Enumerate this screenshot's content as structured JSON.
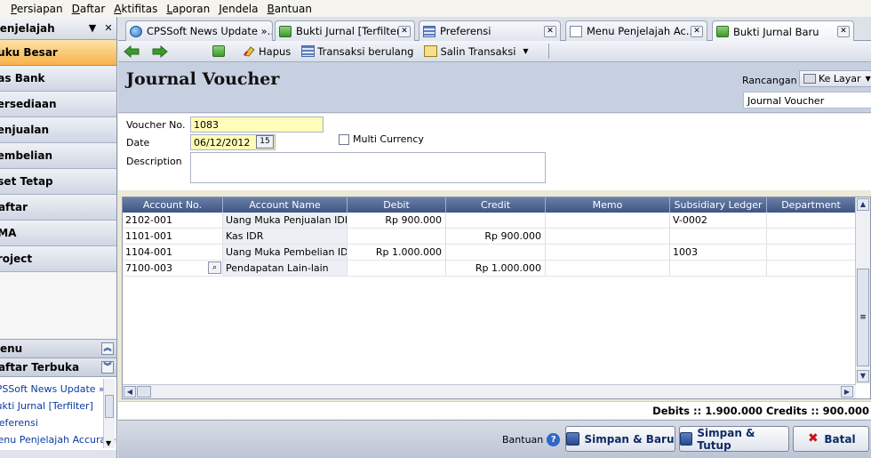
{
  "menubar": {
    "items": [
      "Persiapan",
      "Daftar",
      "Aktifitas",
      "Laporan",
      "Jendela",
      "Bantuan"
    ]
  },
  "sidebar": {
    "title": "Penjelajah",
    "items": [
      "Buku Besar",
      "Kas Bank",
      "Persediaan",
      "Penjualan",
      "Pembelian",
      "Aset Tetap",
      "Daftar",
      "RMA",
      "Project"
    ],
    "section1": "Menu",
    "section2": "Daftar Terbuka",
    "open_list": [
      "CPSSoft News Update »...",
      "Bukti Jurnal [Terfilter]",
      "Preferensi",
      "Menu Penjelajah Accurate"
    ]
  },
  "tabs": [
    {
      "label": "CPSSoft News Update »...",
      "icon": "globe-icon"
    },
    {
      "label": "Bukti Jurnal [Terfilter]",
      "icon": "journal-icon"
    },
    {
      "label": "Preferensi",
      "icon": "settings-icon"
    },
    {
      "label": "Menu Penjelajah Ac...",
      "icon": "document-icon"
    },
    {
      "label": "Bukti Jurnal Baru",
      "icon": "journal-icon"
    }
  ],
  "toolbar": {
    "hapus": "Hapus",
    "transaksi_berulang": "Transaksi berulang",
    "salin_transaksi": "Salin Transaksi"
  },
  "header": {
    "title": "Journal Voucher",
    "rancangan_label": "Rancangan",
    "ke_layar": "Ke Layar",
    "design_value": "Journal Voucher"
  },
  "form": {
    "voucher_label": "Voucher No.",
    "voucher_value": "1083",
    "date_label": "Date",
    "date_value": "06/12/2012",
    "calendar_label": "15",
    "description_label": "Description",
    "multi_currency_label": "Multi Currency"
  },
  "grid": {
    "columns": [
      "Account No.",
      "Account Name",
      "Debit",
      "Credit",
      "Memo",
      "Subsidiary Ledger",
      "Department"
    ],
    "rows": [
      {
        "account_no": "2102-001",
        "account_name": "Uang Muka Penjualan IDR",
        "debit": "Rp 900.000",
        "credit": "",
        "memo": "",
        "subsidiary": "V-0002",
        "department": ""
      },
      {
        "account_no": "1101-001",
        "account_name": "Kas IDR",
        "debit": "",
        "credit": "Rp 900.000",
        "memo": "",
        "subsidiary": "",
        "department": ""
      },
      {
        "account_no": "1104-001",
        "account_name": "Uang Muka Pembelian IDR",
        "debit": "Rp 1.000.000",
        "credit": "",
        "memo": "",
        "subsidiary": "1003",
        "department": ""
      },
      {
        "account_no": "7100-003",
        "account_name": "Pendapatan Lain-lain",
        "debit": "",
        "credit": "Rp 1.000.000",
        "memo": "",
        "subsidiary": "",
        "department": ""
      }
    ]
  },
  "totals": {
    "text": "Debits :: 1.900.000   Credits :: 900.000"
  },
  "footer": {
    "bantuan": "Bantuan",
    "simpan_baru": "Simpan & Baru",
    "simpan_tutup": "Simpan & Tutup",
    "batal": "Batal"
  },
  "colors": {
    "active_nav": "#f7b24c",
    "grid_header": "#3e5684",
    "input_highlight": "#fffdb8"
  }
}
